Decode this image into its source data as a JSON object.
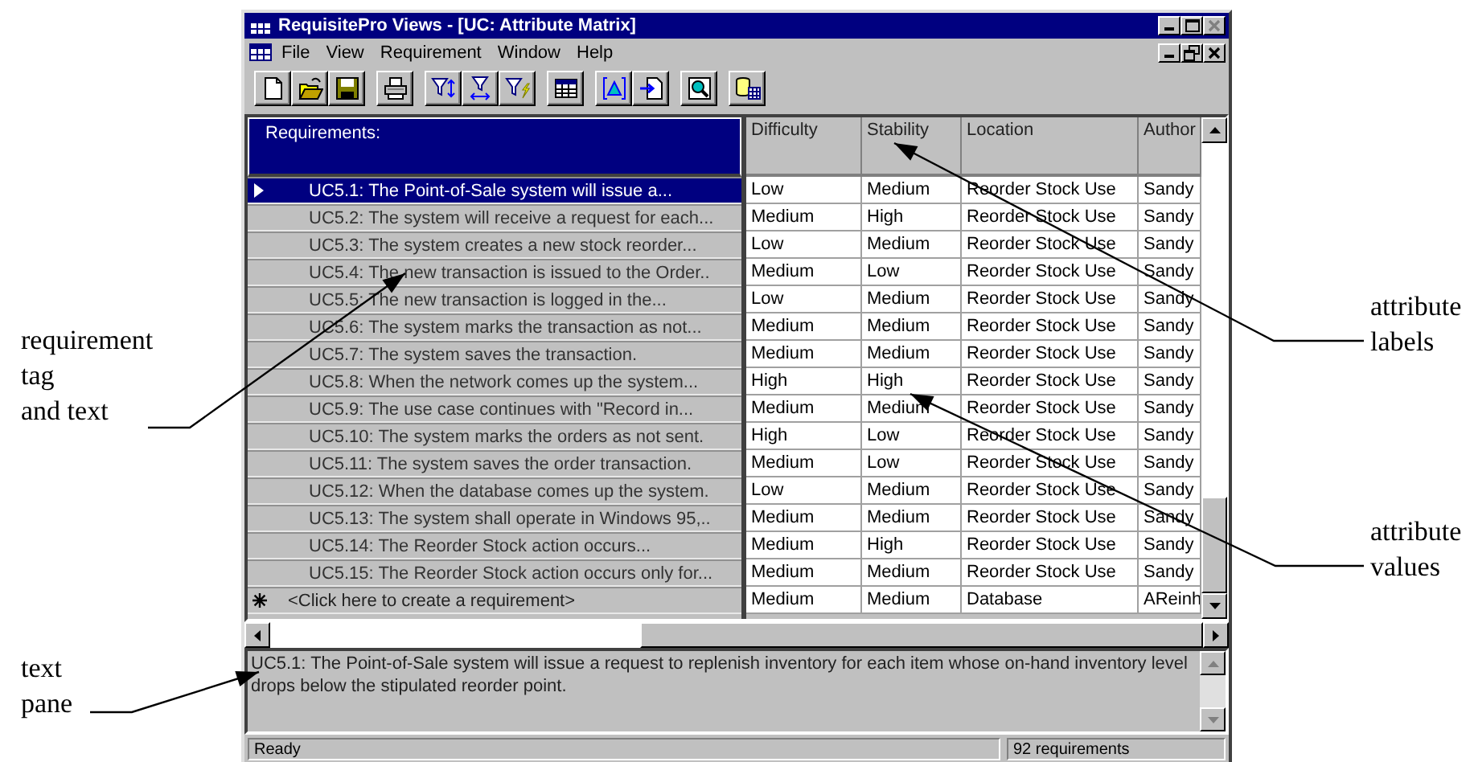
{
  "window": {
    "title": "RequisitePro Views - [UC: Attribute Matrix]"
  },
  "menu": [
    {
      "label": "File"
    },
    {
      "label": "View"
    },
    {
      "label": "Requirement"
    },
    {
      "label": "Window"
    },
    {
      "label": "Help"
    }
  ],
  "toolbar": [
    {
      "buttons": [
        {
          "kind": "new"
        },
        {
          "kind": "open"
        },
        {
          "kind": "save"
        }
      ]
    },
    {
      "buttons": [
        {
          "kind": "print"
        }
      ]
    },
    {
      "buttons": [
        {
          "kind": "filter-sort"
        },
        {
          "kind": "filter-range"
        },
        {
          "kind": "filter-query"
        }
      ]
    },
    {
      "buttons": [
        {
          "kind": "grid"
        }
      ]
    },
    {
      "buttons": [
        {
          "kind": "trace"
        },
        {
          "kind": "import"
        }
      ]
    },
    {
      "buttons": [
        {
          "kind": "find"
        }
      ]
    },
    {
      "buttons": [
        {
          "kind": "database"
        }
      ]
    }
  ],
  "grid": {
    "header": "Requirements:",
    "columns": [
      "Difficulty",
      "Stability",
      "Location",
      "Author"
    ],
    "rows": [
      {
        "kind": "requirement",
        "selected": true,
        "text": "UC5.1: The Point-of-Sale system will issue a...",
        "cells": [
          "Low",
          "Medium",
          "Reorder Stock Use",
          "Sandy"
        ]
      },
      {
        "kind": "requirement",
        "selected": false,
        "text": "UC5.2: The system will receive a request for each...",
        "cells": [
          "Medium",
          "High",
          "Reorder Stock Use",
          "Sandy"
        ]
      },
      {
        "kind": "requirement",
        "selected": false,
        "text": "UC5.3: The system creates a new stock reorder...",
        "cells": [
          "Low",
          "Medium",
          "Reorder Stock Use",
          "Sandy"
        ]
      },
      {
        "kind": "requirement",
        "selected": false,
        "text": "UC5.4: The new transaction is issued to the Order..",
        "cells": [
          "Medium",
          "Low",
          "Reorder Stock Use",
          "Sandy"
        ]
      },
      {
        "kind": "requirement",
        "selected": false,
        "text": "UC5.5: The new transaction is logged in the...",
        "cells": [
          "Low",
          "Medium",
          "Reorder Stock Use",
          "Sandy"
        ]
      },
      {
        "kind": "requirement",
        "selected": false,
        "text": "UC5.6: The system marks the transaction as not...",
        "cells": [
          "Medium",
          "Medium",
          "Reorder Stock Use",
          "Sandy"
        ]
      },
      {
        "kind": "requirement",
        "selected": false,
        "text": "UC5.7: The system saves the transaction.",
        "cells": [
          "Medium",
          "Medium",
          "Reorder Stock Use",
          "Sandy"
        ]
      },
      {
        "kind": "requirement",
        "selected": false,
        "text": "UC5.8: When the network comes up the system...",
        "cells": [
          "High",
          "High",
          "Reorder Stock Use",
          "Sandy"
        ]
      },
      {
        "kind": "requirement",
        "selected": false,
        "text": "UC5.9: The use case continues with \"Record in...",
        "cells": [
          "Medium",
          "Medium",
          "Reorder Stock Use",
          "Sandy"
        ]
      },
      {
        "kind": "requirement",
        "selected": false,
        "text": "UC5.10: The system marks the orders as not sent.",
        "cells": [
          "High",
          "Low",
          "Reorder Stock Use",
          "Sandy"
        ]
      },
      {
        "kind": "requirement",
        "selected": false,
        "text": "UC5.11: The system saves the order transaction.",
        "cells": [
          "Medium",
          "Low",
          "Reorder Stock Use",
          "Sandy"
        ]
      },
      {
        "kind": "requirement",
        "selected": false,
        "text": "UC5.12: When the database comes up the system.",
        "cells": [
          "Low",
          "Medium",
          "Reorder Stock Use",
          "Sandy"
        ]
      },
      {
        "kind": "requirement",
        "selected": false,
        "text": "UC5.13: The system shall operate in Windows 95,..",
        "cells": [
          "Medium",
          "Medium",
          "Reorder Stock Use",
          "Sandy"
        ]
      },
      {
        "kind": "requirement",
        "selected": false,
        "text": "UC5.14: The Reorder Stock action occurs...",
        "cells": [
          "Medium",
          "High",
          "Reorder Stock Use",
          "Sandy"
        ]
      },
      {
        "kind": "requirement",
        "selected": false,
        "text": "UC5.15: The Reorder Stock action occurs only for...",
        "cells": [
          "Medium",
          "Medium",
          "Reorder Stock Use",
          "Sandy"
        ]
      },
      {
        "kind": "new",
        "selected": false,
        "text": "<Click here to create a requirement>",
        "cells": [
          "Medium",
          "Medium",
          "Database",
          "AReinh"
        ]
      }
    ]
  },
  "text_pane": {
    "text": "UC5.1: The Point-of-Sale system will issue a request to replenish inventory for each item whose on-hand inventory level drops below the stipulated reorder point."
  },
  "status_bar": {
    "message": "Ready",
    "count": "92 requirements"
  },
  "annotations": [
    {
      "lines": [
        "requirement",
        "tag",
        "and text"
      ]
    },
    {
      "lines": [
        "attribute",
        "labels"
      ]
    },
    {
      "lines": [
        "attribute",
        "values"
      ]
    },
    {
      "lines": [
        "text",
        "pane"
      ]
    }
  ]
}
